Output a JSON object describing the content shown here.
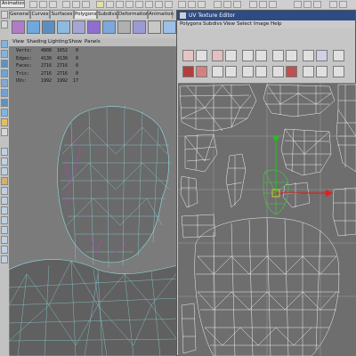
{
  "menu": {
    "mode": "Animation"
  },
  "shelf": {
    "tabs": [
      "General",
      "Curves",
      "Surfaces",
      "Polygons",
      "Subdivs",
      "Deformation",
      "Animation"
    ],
    "active_tab": "Polygons"
  },
  "viewport": {
    "menu": [
      "View",
      "Shading",
      "Lighting",
      "Show",
      "Panels"
    ],
    "hud": [
      {
        "label": "Verts:",
        "a": "4808",
        "b": "1652",
        "c": "0"
      },
      {
        "label": "Edges:",
        "a": "4130",
        "b": "4130",
        "c": "0"
      },
      {
        "label": "Faces:",
        "a": "2716",
        "b": "2716",
        "c": "0"
      },
      {
        "label": "Tris:",
        "a": "2716",
        "b": "2716",
        "c": "0"
      },
      {
        "label": "UVs:",
        "a": "1992",
        "b": "1992",
        "c": "17"
      }
    ]
  },
  "uv_editor": {
    "title": "UV Texture Editor",
    "menu": [
      "Polygons",
      "Subdivs",
      "View",
      "Select",
      "Image",
      "Help"
    ]
  },
  "colors": {
    "title_bar": "#2e4b84",
    "wire_viewport": "#8fe0e8",
    "wire_selected": "#c23cc2",
    "uv_wire": "#ffffff",
    "uv_selected": "#3fd23f",
    "manip_red": "#e02020",
    "manip_green": "#20c020"
  },
  "icons": [
    "select-tool-icon",
    "lasso-icon",
    "move-icon",
    "rotate-icon",
    "scale-icon",
    "sphere-icon",
    "cube-icon",
    "cylinder-icon",
    "cone-icon",
    "plane-icon",
    "torus-icon"
  ]
}
